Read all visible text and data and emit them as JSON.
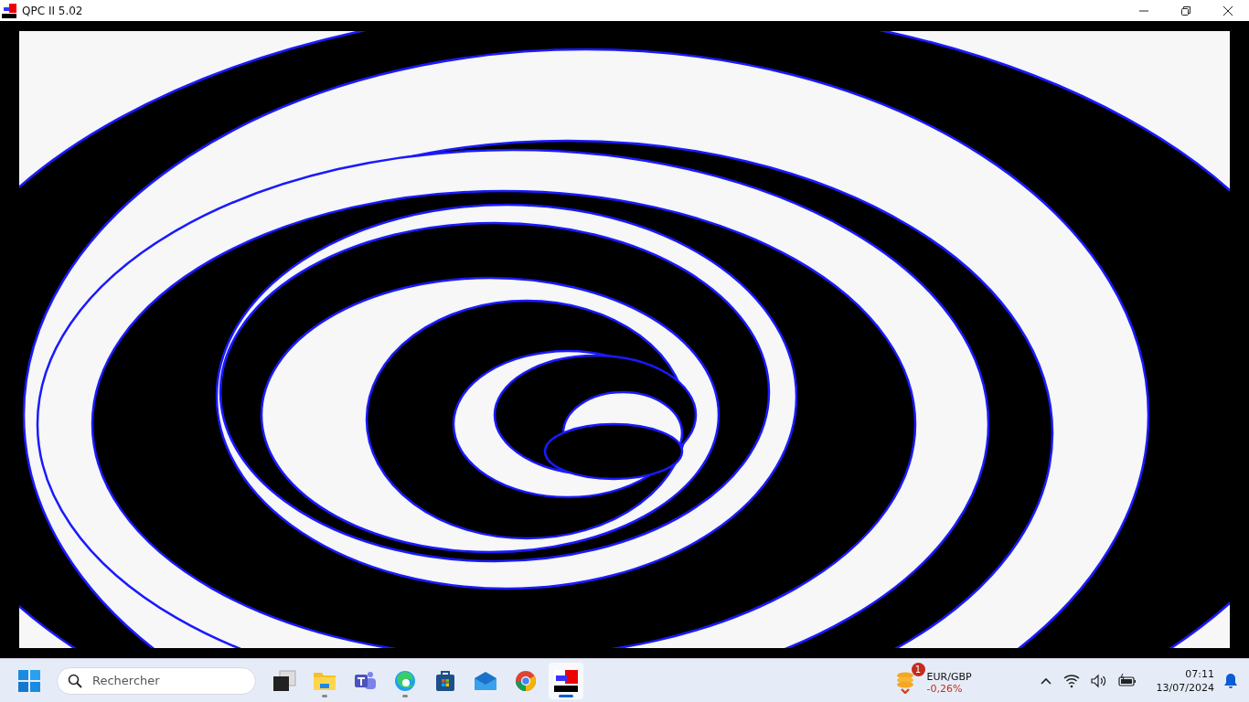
{
  "window": {
    "title": "QPC II 5.02"
  },
  "taskbar": {
    "search": {
      "placeholder": "Rechercher"
    },
    "apps": [
      {
        "kind": "task-view",
        "running": false,
        "selected": false
      },
      {
        "kind": "folder",
        "running": true,
        "selected": false
      },
      {
        "kind": "teams",
        "running": false,
        "selected": false
      },
      {
        "kind": "edge",
        "running": true,
        "selected": false
      },
      {
        "kind": "store",
        "running": false,
        "selected": false
      },
      {
        "kind": "mail",
        "running": false,
        "selected": false
      },
      {
        "kind": "chrome",
        "running": false,
        "selected": false
      },
      {
        "kind": "qpc",
        "running": true,
        "selected": true
      }
    ],
    "widget": {
      "badge": "1",
      "title": "EUR/GBP",
      "change": "-0,26%"
    },
    "clock": {
      "time": "07:11",
      "date": "13/07/2024"
    }
  }
}
